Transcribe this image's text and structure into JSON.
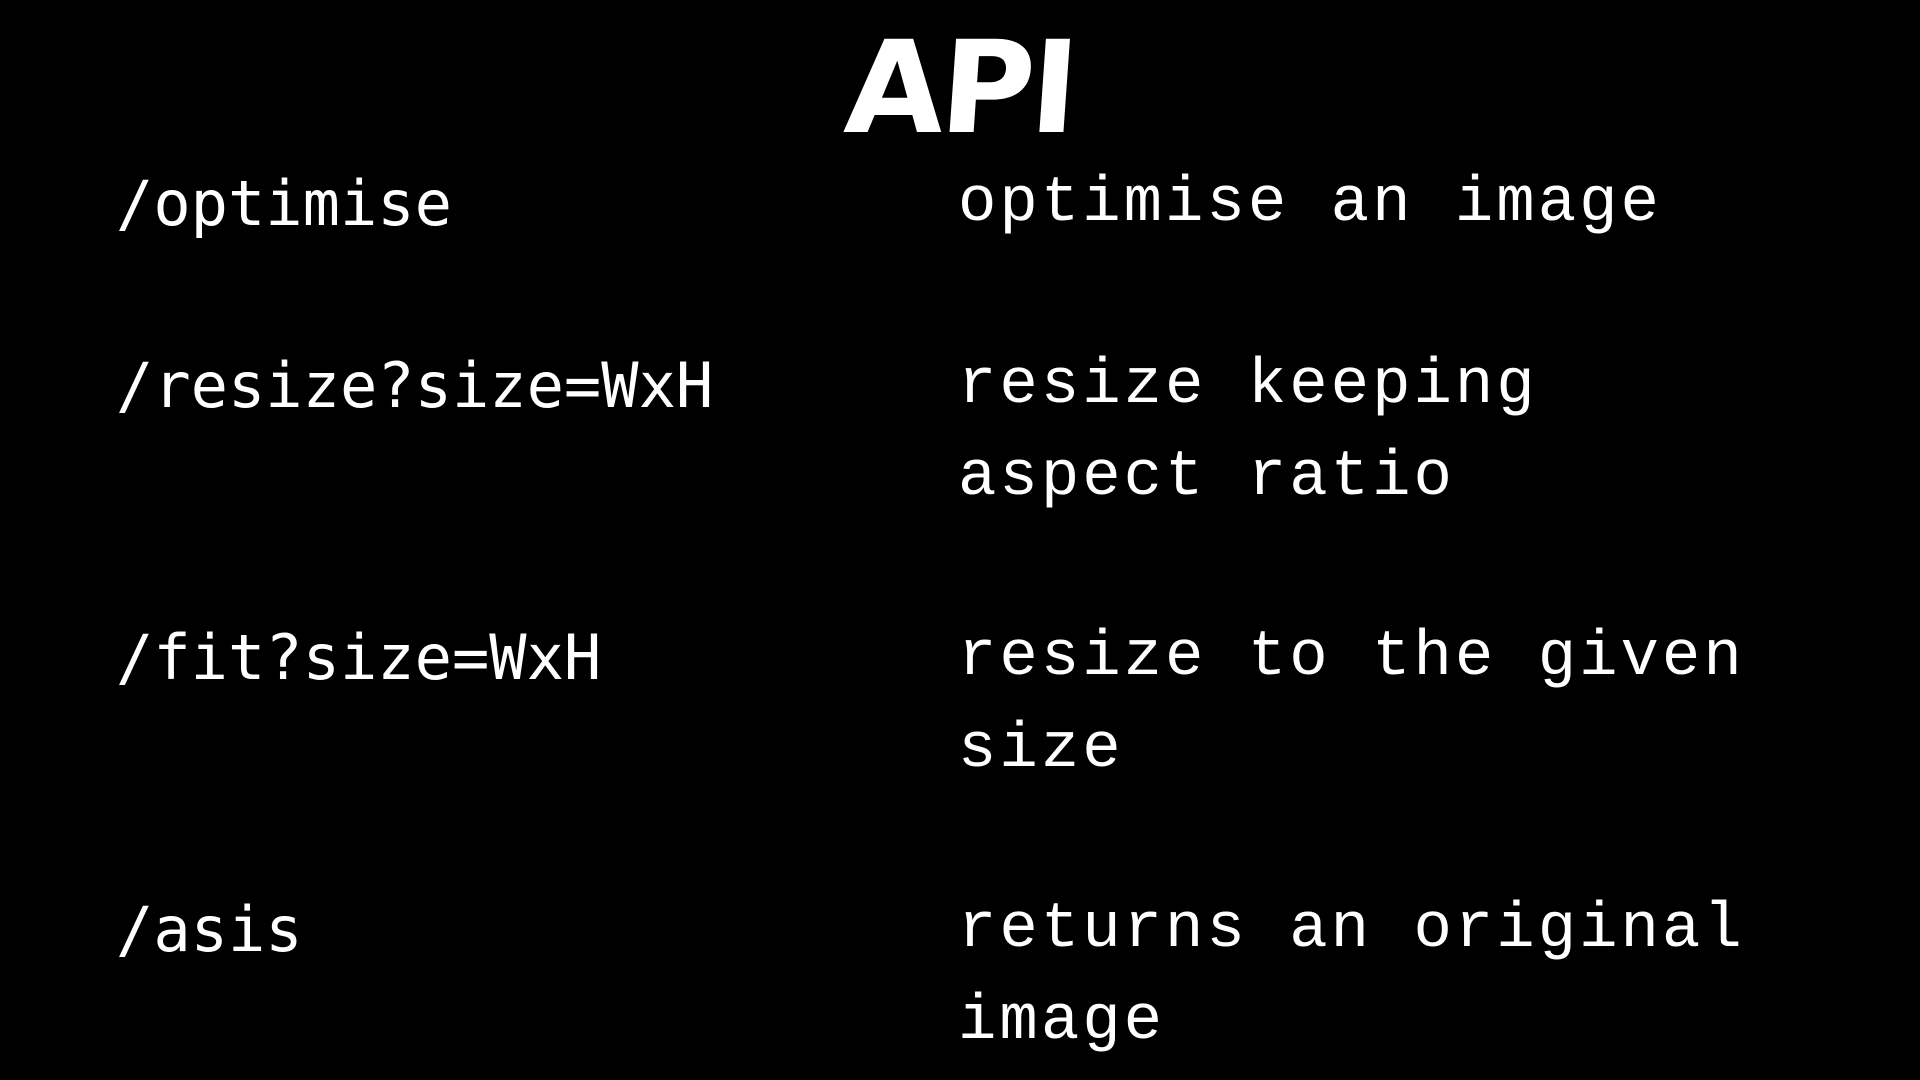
{
  "slide": {
    "title": "API",
    "endpoints": [
      {
        "path": "/optimise",
        "description": "optimise an image"
      },
      {
        "path": "/resize?size=WxH",
        "description": "resize keeping\naspect ratio"
      },
      {
        "path": "/fit?size=WxH",
        "description": "resize to the given\nsize"
      },
      {
        "path": "/asis",
        "description": "returns an original\nimage"
      }
    ]
  }
}
